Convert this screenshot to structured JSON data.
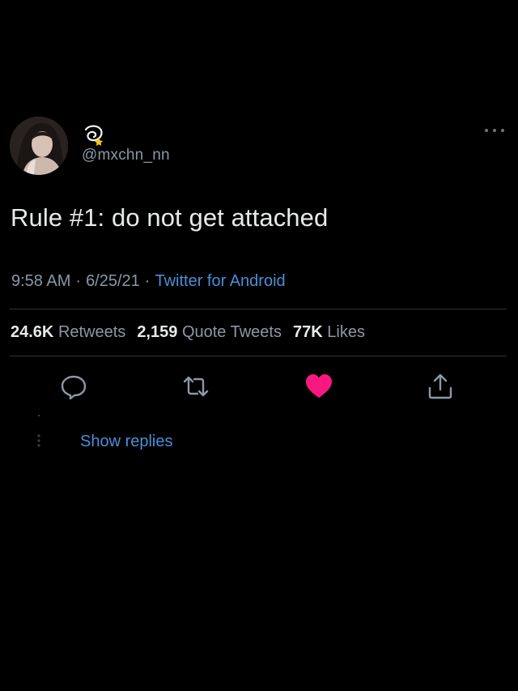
{
  "user": {
    "avatar_icon": "profile-photo",
    "name_emoji_icon": "dizzy-emoji-icon",
    "handle": "@mxchn_nn"
  },
  "tweet": {
    "text": "Rule #1: do not get attached",
    "time": "9:58 AM",
    "date": "6/25/21",
    "separator": "·",
    "source": "Twitter for Android"
  },
  "stats": {
    "retweets_count": "24.6K",
    "retweets_label": "Retweets",
    "quotes_count": "2,159",
    "quotes_label": "Quote Tweets",
    "likes_count": "77K",
    "likes_label": "Likes"
  },
  "actions": {
    "reply_icon": "reply-icon",
    "retweet_icon": "retweet-icon",
    "like_icon": "heart-icon",
    "like_active": true,
    "share_icon": "share-icon"
  },
  "replies": {
    "show_label": "Show replies"
  },
  "colors": {
    "background": "#000000",
    "text_primary": "#e7e9ea",
    "text_secondary": "#8b98a5",
    "link": "#4a8fd8",
    "like": "#f91880",
    "divider": "#2f3336"
  }
}
